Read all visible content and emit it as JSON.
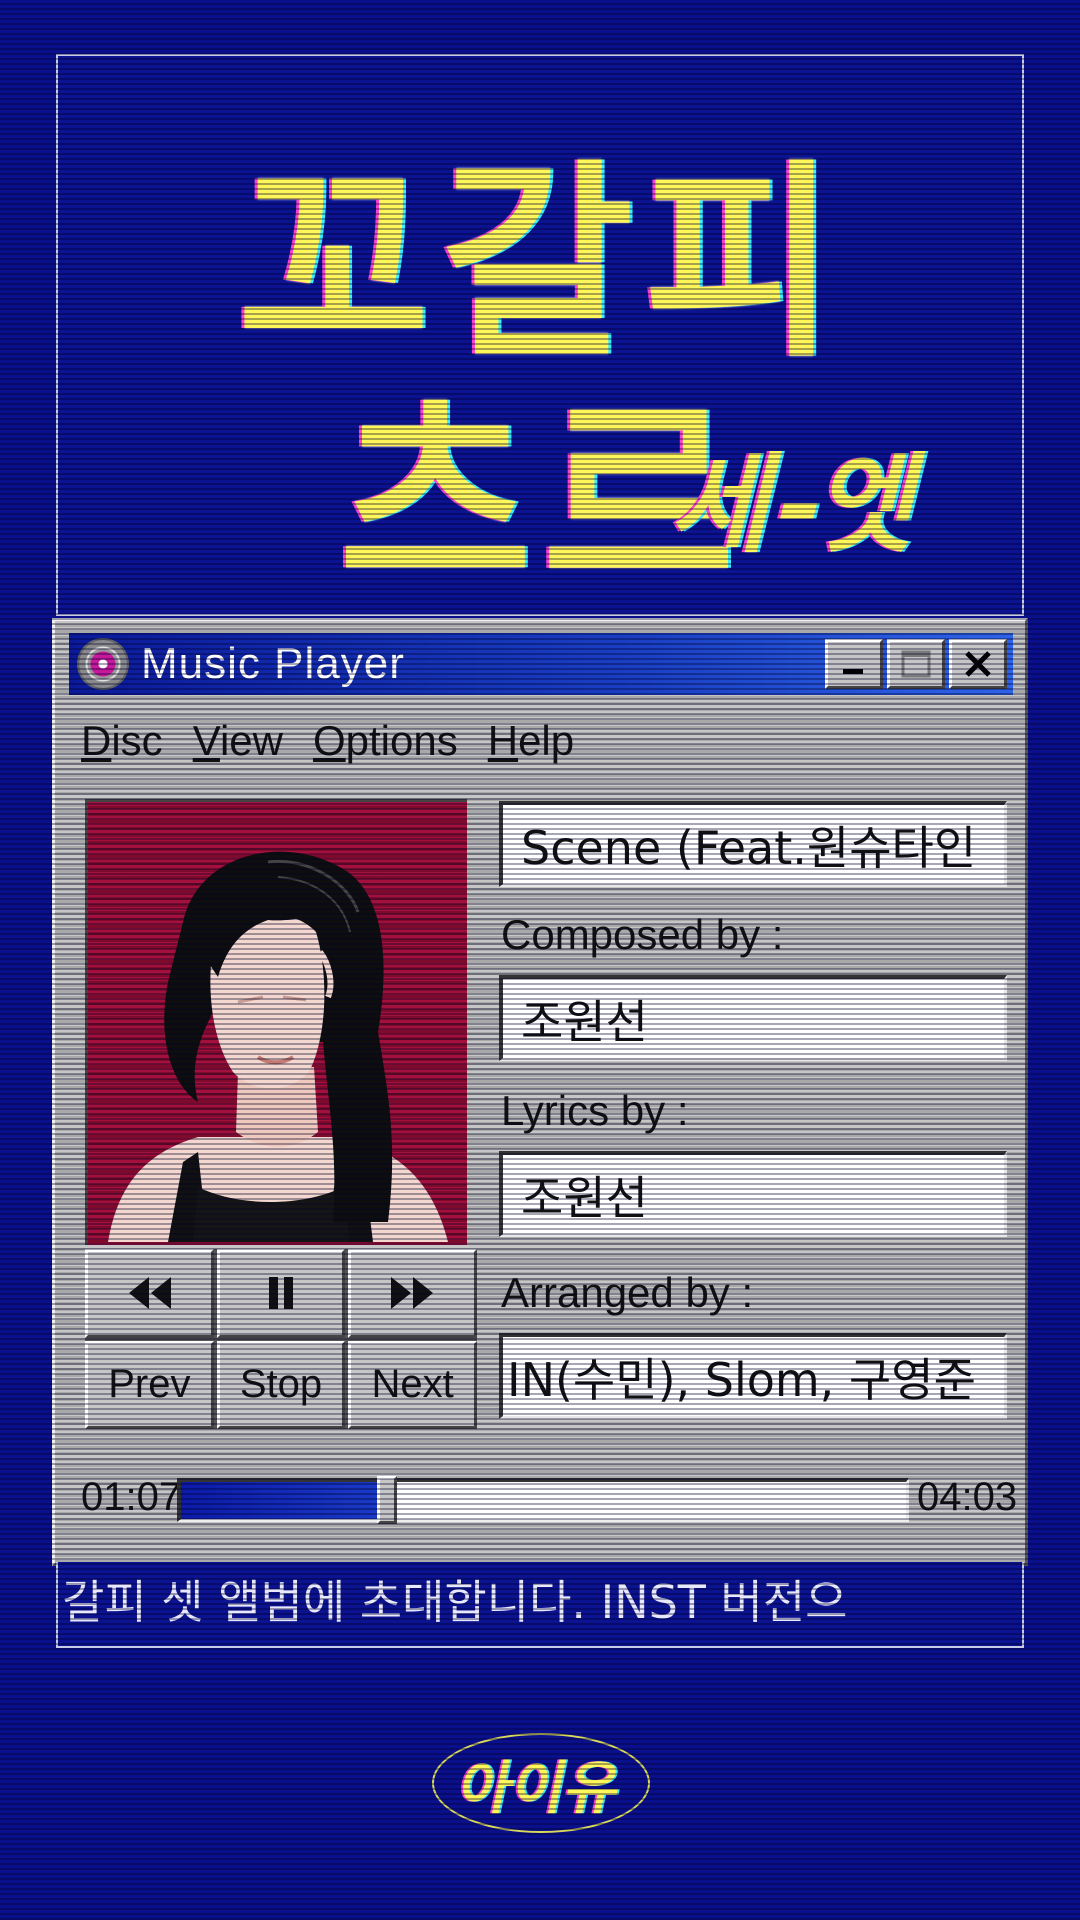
{
  "album": {
    "title_main": "꼬갈피\n츠르",
    "title_sub": "세-엣",
    "logo_text": "아이유"
  },
  "window": {
    "title": "Music Player",
    "title_icon": "disc-icon",
    "controls": {
      "minimize": "_",
      "maximize": "□",
      "close": "X"
    }
  },
  "menu": {
    "items": [
      "Disc",
      "View",
      "Options",
      "Help"
    ]
  },
  "player": {
    "track_title": "Scene (Feat.원슈타인",
    "composed_label": "Composed by :",
    "composed_value": "조원선",
    "lyrics_label": "Lyrics by :",
    "lyrics_value": "조원선",
    "arranged_label": "Arranged by :",
    "arranged_value": "IN(수민), Slom, 구영준",
    "transport": {
      "rewind_icon": "rewind-icon",
      "pause_icon": "pause-icon",
      "forward_icon": "fast-forward-icon",
      "prev_label": "Prev",
      "stop_label": "Stop",
      "next_label": "Next"
    },
    "time_current": "01:07",
    "time_total": "04:03",
    "progress_fraction": 0.276
  },
  "marquee": {
    "text": "갈피 셋 앨범에 초대합니다.    INST 버전으"
  },
  "colors": {
    "background": "#0a0f8c",
    "title_yellow": "#fff65a",
    "titlebar_blue": "#1a3fc4",
    "art_red": "#a3103c"
  }
}
